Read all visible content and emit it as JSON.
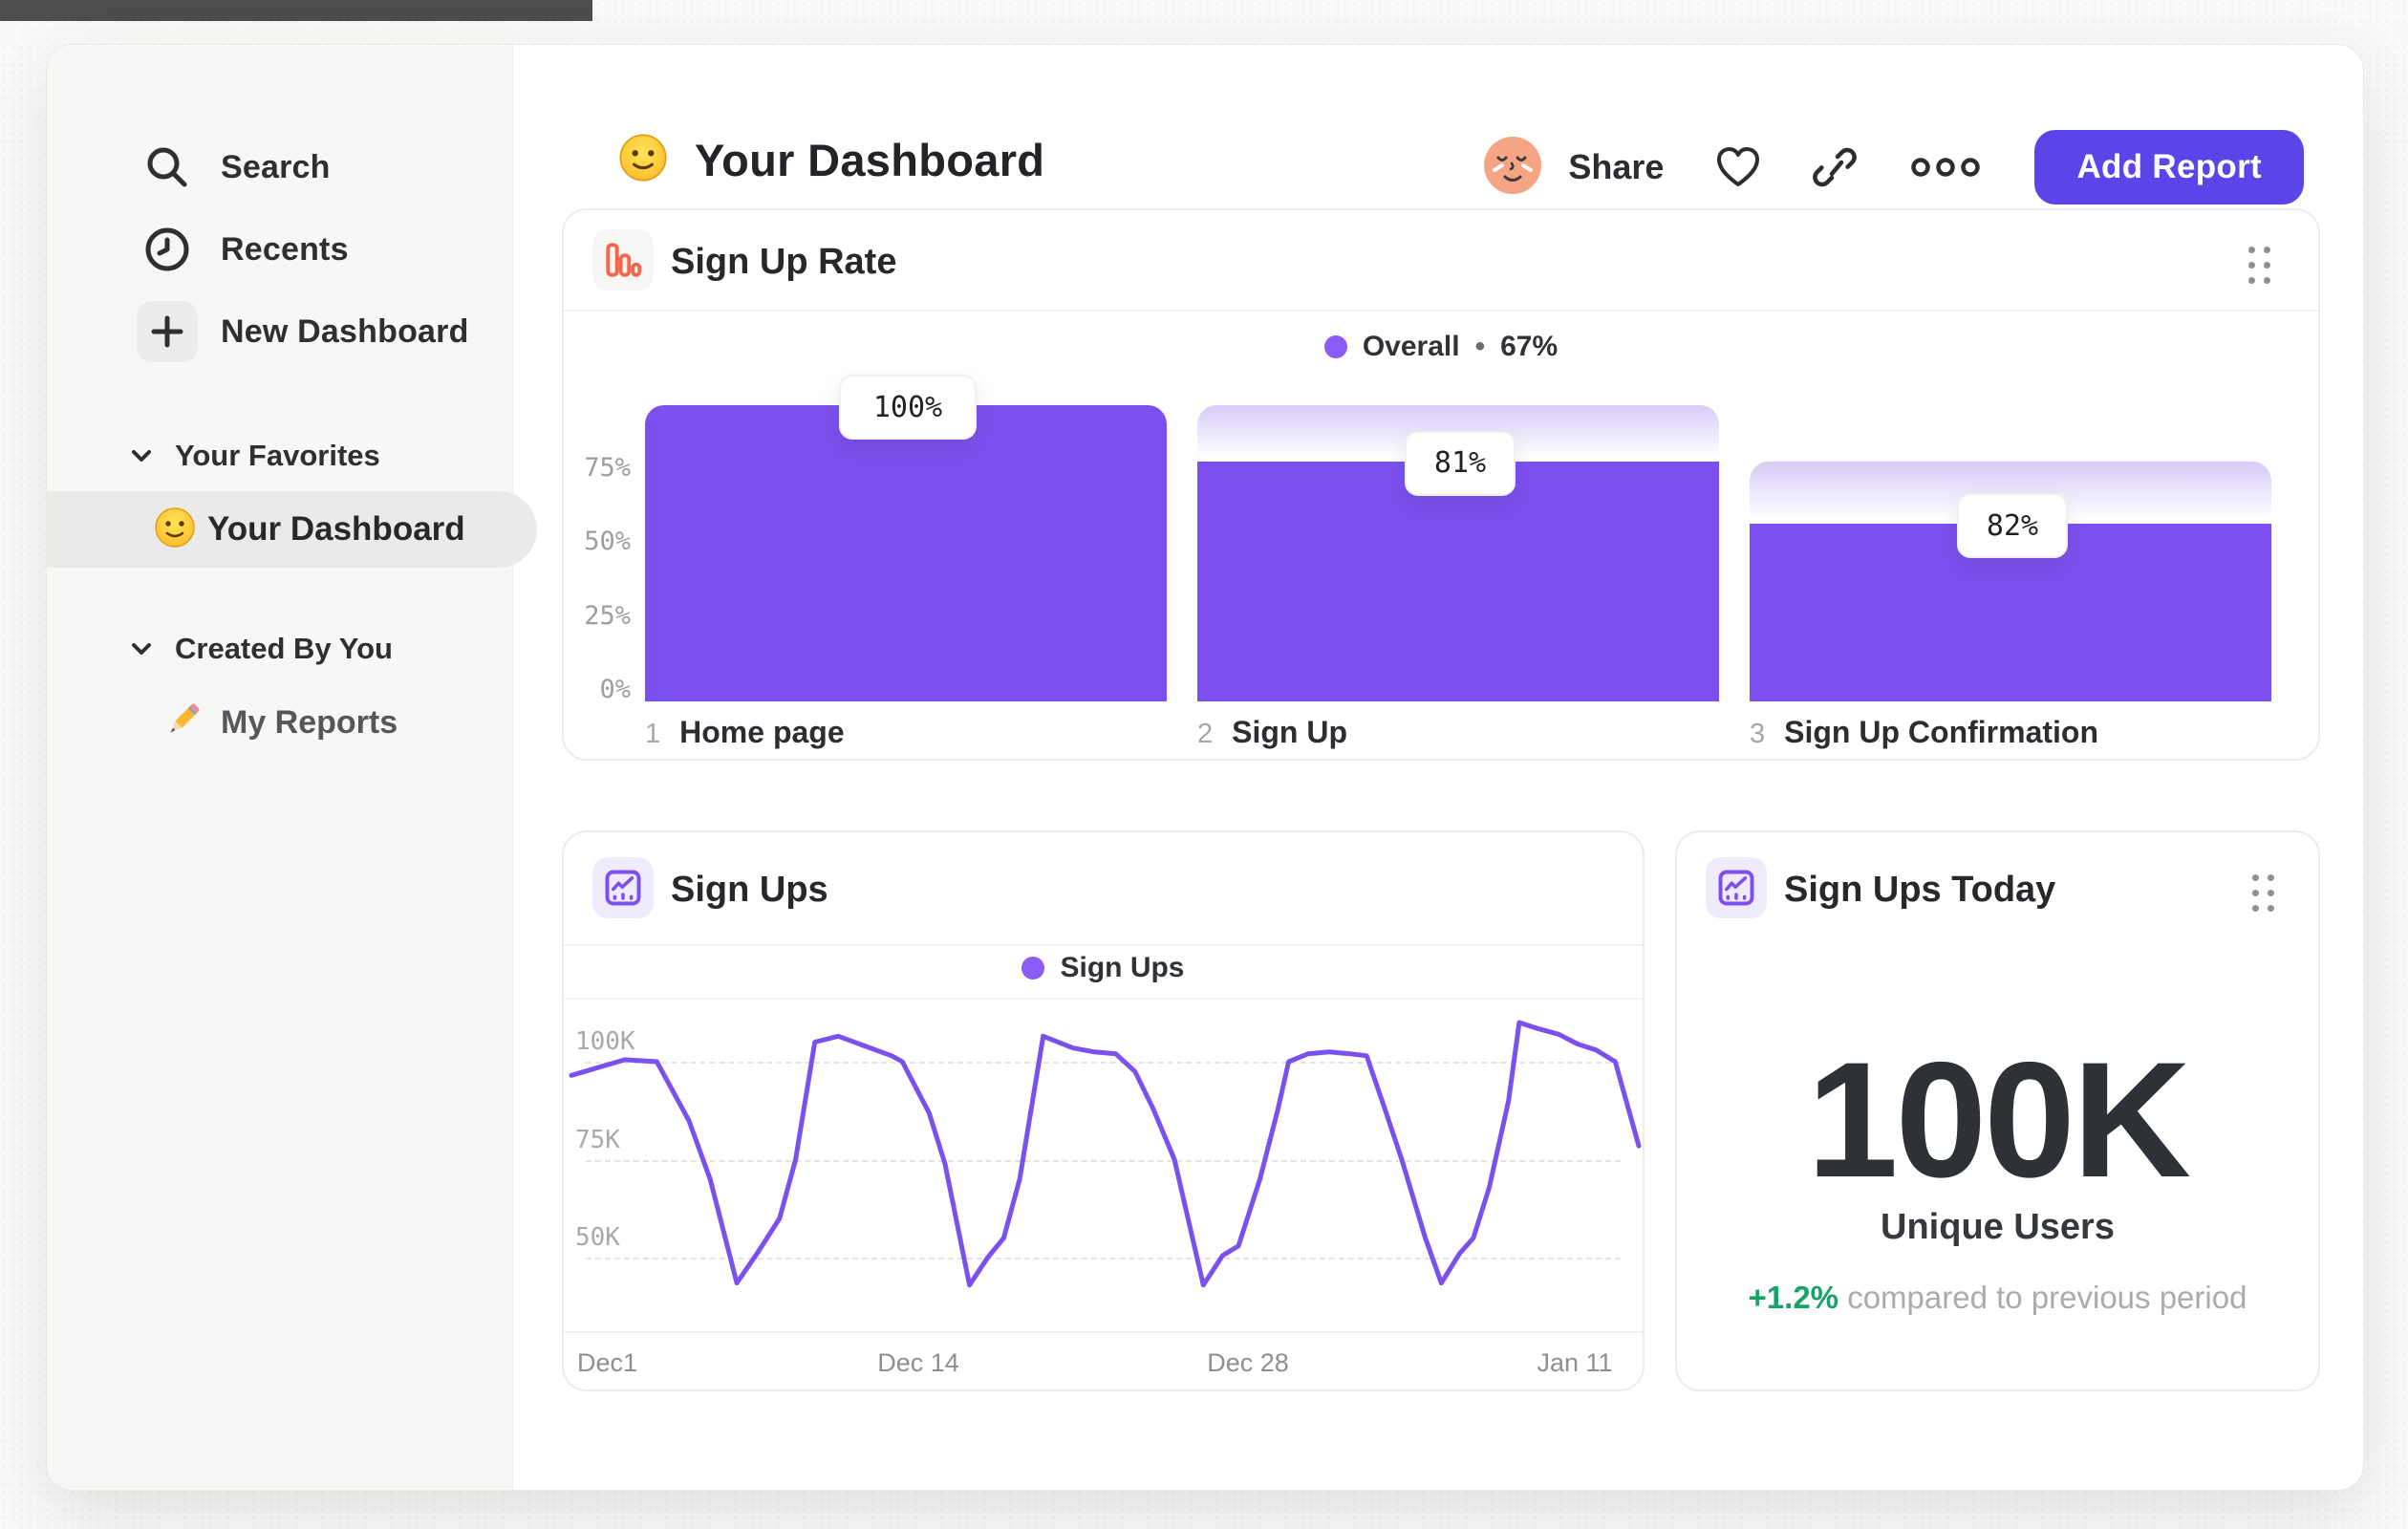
{
  "colors": {
    "accent_purple": "#7c50ee",
    "legend_dot": "#8b5cf6",
    "button_purple": "#5a45e8",
    "funnel_icon_coral": "#f2684c",
    "delta_green": "#17a266",
    "ghost_gradient_top": "#d6cbf7",
    "sidebar_bg": "#f7f7f5"
  },
  "sidebar": {
    "items": [
      {
        "label": "Search",
        "icon": "search-icon"
      },
      {
        "label": "Recents",
        "icon": "clock-icon"
      },
      {
        "label": "New Dashboard",
        "icon": "plus-icon"
      }
    ],
    "sections": [
      {
        "title": "Your Favorites",
        "items": [
          {
            "label": "Your Dashboard",
            "emoji": "slightly-smiling-face",
            "selected": true
          }
        ]
      },
      {
        "title": "Created By You",
        "items": [
          {
            "label": "My Reports",
            "emoji": "pencil",
            "selected": false
          }
        ]
      }
    ]
  },
  "header": {
    "emoji": "slightly-smiling-face",
    "title": "Your Dashboard",
    "share_label": "Share",
    "add_report_label": "Add Report"
  },
  "cards": {
    "metric": {
      "title": "Sign Ups Today",
      "value": "100K",
      "label": "Unique Users",
      "delta": "+1.2%",
      "delta_note": "compared to previous period"
    }
  },
  "chart_data": [
    {
      "type": "bar",
      "subtype": "funnel",
      "title": "Sign Up Rate",
      "legend": {
        "name": "Overall",
        "sep": "•",
        "value": "67%"
      },
      "yticks": [
        {
          "label": "0%",
          "pct": 0
        },
        {
          "label": "25%",
          "pct": 25
        },
        {
          "label": "50%",
          "pct": 50
        },
        {
          "label": "75%",
          "pct": 75
        }
      ],
      "ylim": [
        0,
        100
      ],
      "grid": false,
      "legend_position": "top-center",
      "steps": [
        {
          "index": "1",
          "label": "Home page",
          "value_label": "100%",
          "bar_top_pct": 100,
          "ghost_top_pct": null
        },
        {
          "index": "2",
          "label": "Sign Up",
          "value_label": "81%",
          "bar_top_pct": 81,
          "ghost_top_pct": 100
        },
        {
          "index": "3",
          "label": "Sign Up Confirmation",
          "value_label": "82%",
          "bar_top_pct": 60,
          "ghost_top_pct": 81
        }
      ]
    },
    {
      "type": "line",
      "title": "Sign Ups",
      "legend": {
        "name": "Sign Ups"
      },
      "legend_position": "top-center",
      "yticks": [
        {
          "label": "50K",
          "value": 50
        },
        {
          "label": "75K",
          "value": 75
        },
        {
          "label": "100K",
          "value": 100
        }
      ],
      "xticks": [
        "Dec1",
        "Dec 14",
        "Dec 28",
        "Jan 11"
      ],
      "ylabel": "",
      "xlabel": "",
      "grid": "dashed-horizontal",
      "units": "thousands of sign ups",
      "points_x_fraction_value_k": [
        [
          0.0,
          96.5
        ],
        [
          0.05,
          100.5
        ],
        [
          0.08,
          100.0
        ],
        [
          0.11,
          85.0
        ],
        [
          0.13,
          70.0
        ],
        [
          0.155,
          43.5
        ],
        [
          0.175,
          51.5
        ],
        [
          0.195,
          60.0
        ],
        [
          0.21,
          75.0
        ],
        [
          0.228,
          105.0
        ],
        [
          0.25,
          106.5
        ],
        [
          0.275,
          104.0
        ],
        [
          0.3,
          101.5
        ],
        [
          0.31,
          100.0
        ],
        [
          0.335,
          87.0
        ],
        [
          0.35,
          74.0
        ],
        [
          0.373,
          43.0
        ],
        [
          0.39,
          50.0
        ],
        [
          0.405,
          55.0
        ],
        [
          0.42,
          70.0
        ],
        [
          0.442,
          106.5
        ],
        [
          0.47,
          103.5
        ],
        [
          0.49,
          102.5
        ],
        [
          0.51,
          102.0
        ],
        [
          0.528,
          97.5
        ],
        [
          0.545,
          88.0
        ],
        [
          0.565,
          75.0
        ],
        [
          0.592,
          43.0
        ],
        [
          0.61,
          50.5
        ],
        [
          0.625,
          53.0
        ],
        [
          0.645,
          70.0
        ],
        [
          0.662,
          88.0
        ],
        [
          0.672,
          100.0
        ],
        [
          0.69,
          102.0
        ],
        [
          0.71,
          102.5
        ],
        [
          0.73,
          102.0
        ],
        [
          0.745,
          101.5
        ],
        [
          0.762,
          88.0
        ],
        [
          0.778,
          75.0
        ],
        [
          0.8,
          55.0
        ],
        [
          0.815,
          43.5
        ],
        [
          0.832,
          51.0
        ],
        [
          0.845,
          55.0
        ],
        [
          0.86,
          68.0
        ],
        [
          0.878,
          90.0
        ],
        [
          0.888,
          110.0
        ],
        [
          0.905,
          108.5
        ],
        [
          0.925,
          107.0
        ],
        [
          0.943,
          104.5
        ],
        [
          0.96,
          103.0
        ],
        [
          0.978,
          100.0
        ],
        [
          1.0,
          78.5
        ]
      ]
    }
  ]
}
